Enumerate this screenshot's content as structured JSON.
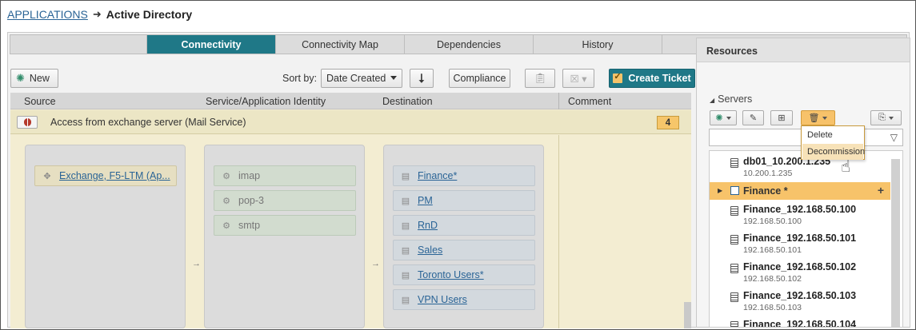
{
  "breadcrumb": {
    "root": "APPLICATIONS",
    "current": "Active Directory"
  },
  "tabs": [
    "Connectivity",
    "Connectivity Map",
    "Dependencies",
    "History"
  ],
  "active_tab": "Connectivity",
  "toolbar": {
    "new_label": "New",
    "sort_label": "Sort by:",
    "sort_value": "Date Created",
    "compliance_label": "Compliance",
    "create_ticket_label": "Create Ticket"
  },
  "grid": {
    "columns": [
      "Source",
      "Service/Application Identity",
      "Destination",
      "Comment"
    ],
    "rule": {
      "text": "Access from exchange server (Mail Service)",
      "count": "4"
    },
    "sources": [
      "Exchange, F5-LTM (Ap..."
    ],
    "services": [
      "imap",
      "pop-3",
      "smtp"
    ],
    "destinations": [
      "Finance*",
      "PM",
      "RnD",
      "Sales",
      "Toronto Users*",
      "VPN Users"
    ]
  },
  "resources": {
    "title": "Resources",
    "section": "Servers",
    "menu": [
      "Delete",
      "Decommission"
    ],
    "group": {
      "name": "Finance *"
    },
    "top_server": {
      "name": "db01_10.200.1.235",
      "ip": "10.200.1.235"
    },
    "servers": [
      {
        "name": "Finance_192.168.50.100",
        "ip": "192.168.50.100"
      },
      {
        "name": "Finance_192.168.50.101",
        "ip": "192.168.50.101"
      },
      {
        "name": "Finance_192.168.50.102",
        "ip": "192.168.50.102"
      },
      {
        "name": "Finance_192.168.50.103",
        "ip": "192.168.50.103"
      },
      {
        "name": "Finance_192.168.50.104",
        "ip": ""
      }
    ]
  },
  "colors": {
    "accent": "#1f7887",
    "highlight": "#f7c36a",
    "link": "#2a6496"
  }
}
